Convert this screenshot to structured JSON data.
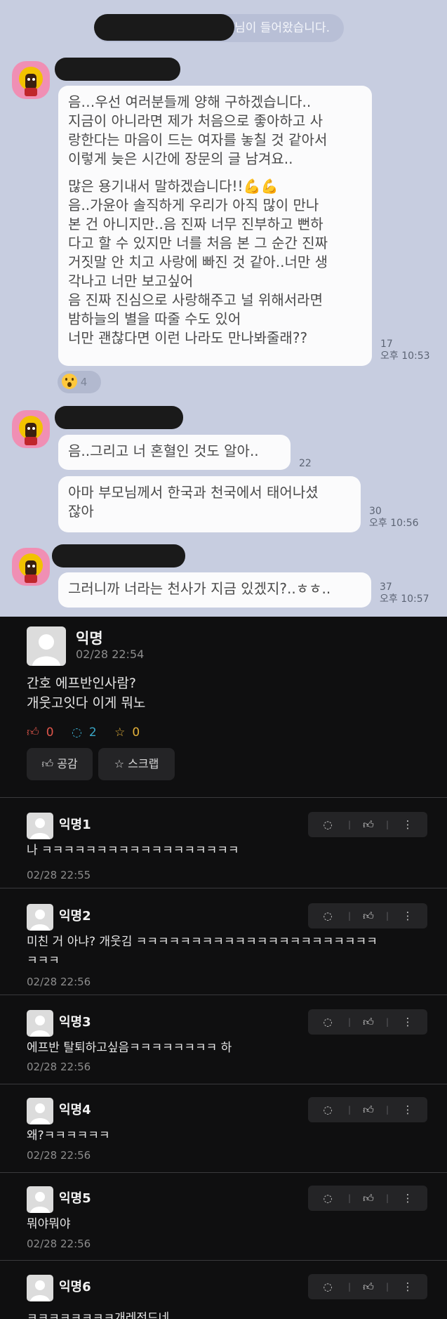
{
  "kakao": {
    "system_notice": "님이 들어왔습니다.",
    "messages": [
      {
        "lines": [
          "음…우선 여러분들께 양해 구하겠습니다..",
          "지금이 아니라면 제가 처음으로 좋아하고 사",
          "랑한다는 마음이 드는 여자를 놓칠 것 같아서",
          "이렇게 늦은 시간에 장문의 글 남겨요..",
          "많은 용기내서 말하겠습니다!!💪💪",
          "음..가윤아 솔직하게 우리가 아직 많이 만나",
          "본 건 아니지만..음 진짜 너무 진부하고 뻔하",
          "다고 할 수 있지만 너를 처음 본 그 순간 진짜",
          "거짓말 안 치고 사랑에 빠진 것 같아..너만 생",
          "각나고 너만 보고싶어",
          "음 진짜 진심으로 사랑해주고 널 위해서라면",
          "밤하늘의 별을 따줄 수도 있어",
          "너만 괜찮다면 이런 나라도 만나봐줄래??"
        ],
        "unread": "17",
        "time": "오후 10:53",
        "reaction_count": "4"
      },
      {
        "lines": [
          "음..그리고 너 혼혈인 것도 알아.."
        ],
        "unread": "22",
        "time": ""
      },
      {
        "lines": [
          "아마 부모님께서 한국과 천국에서 태어나셨",
          "잖아"
        ],
        "unread": "30",
        "time": "오후 10:56"
      },
      {
        "lines": [
          "그러니까 너라는 천사가 지금 있겠지?..ㅎㅎ.."
        ],
        "unread": "37",
        "time": "오후 10:57"
      }
    ]
  },
  "community": {
    "post": {
      "author": "익명",
      "time": "02/28 22:54",
      "body": [
        "간호 에프반인사람?",
        "개웃고잇다 이게 뭐노"
      ],
      "likes": "0",
      "comments": "2",
      "scraps": "0",
      "like_button": "공감",
      "scrap_button": "스크랩"
    },
    "comments": [
      {
        "name": "익명1",
        "lines": [
          "나 ㅋㅋㅋㅋㅋㅋㅋㅋㅋㅋㅋㅋㅋㅋㅋㅋㅋㅋ"
        ],
        "time": "02/28 22:55"
      },
      {
        "name": "익명2",
        "lines": [
          "미친 거 아냐? 개웃김 ㅋㅋㅋㅋㅋㅋㅋㅋㅋㅋㅋㅋㅋㅋㅋㅋㅋㅋㅋㅋㅋㅋ",
          "ㅋㅋㅋ"
        ],
        "time": "02/28 22:56"
      },
      {
        "name": "익명3",
        "lines": [
          "에프반 탈퇴하고싶음ㅋㅋㅋㅋㅋㅋㅋㅋ 하"
        ],
        "time": "02/28 22:56"
      },
      {
        "name": "익명4",
        "lines": [
          "왜?ㅋㅋㅋㅋㅋㅋ"
        ],
        "time": "02/28 22:56"
      },
      {
        "name": "익명5",
        "lines": [
          "뭐야뭐야"
        ],
        "time": "02/28 22:56"
      },
      {
        "name": "익명6",
        "lines": [
          "ㅋㅋㅋㅋㅋㅋㅋㅋ개레전드네"
        ],
        "time": ""
      }
    ]
  },
  "icons": {
    "avatar": "character-avatar-icon",
    "reaction": "surprised-face-icon",
    "like": "thumbs-up-icon",
    "comment": "speech-bubble-icon",
    "scrap": "star-icon",
    "more": "more-vertical-icon",
    "profile": "default-profile-icon"
  },
  "colors": {
    "kakao_bg": "#c7cde0",
    "bubble": "#fbfbfc",
    "community_bg": "#0f0f10",
    "like": "#e0564b",
    "comment": "#3aa7c7",
    "scrap": "#e3b13a"
  }
}
